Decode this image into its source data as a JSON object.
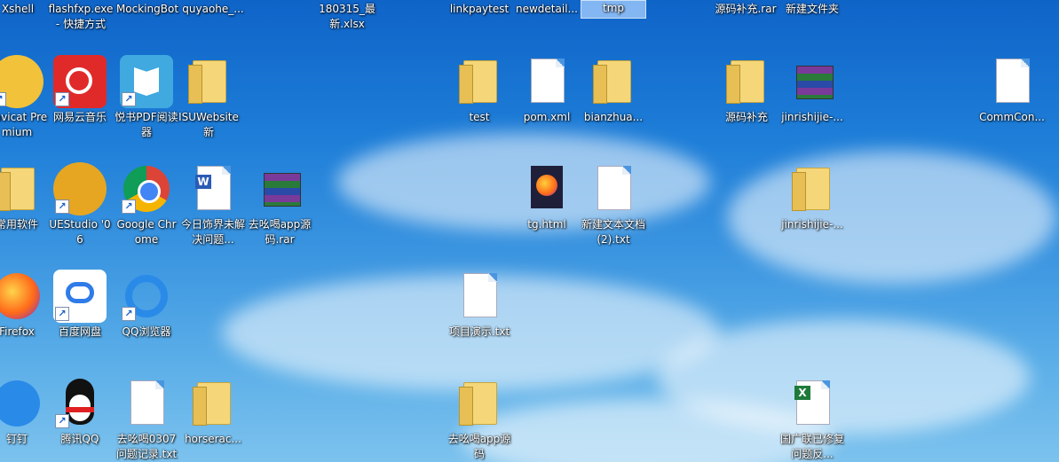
{
  "desktop": {
    "top_row": [
      {
        "label": "Xshell"
      },
      {
        "label": "flashfxp.exe - 快捷方式"
      },
      {
        "label": "MockingBot"
      },
      {
        "label": "quyaohe_..."
      },
      {
        "label": "180315_最新.xlsx"
      },
      {
        "label": "linkpaytest"
      },
      {
        "label": "newdetail..."
      },
      {
        "label": "tmp",
        "selected": true
      },
      {
        "label": "源码补充.rar"
      },
      {
        "label": "新建文件夹"
      }
    ],
    "icons": [
      {
        "label": "Navicat Premium",
        "icon": "navicat-icon",
        "color": "#f2c23a"
      },
      {
        "label": "网易云音乐",
        "icon": "netease-music-icon",
        "color": "#e02a2a"
      },
      {
        "label": "悦书PDF阅读器",
        "icon": "pdf-reader-icon",
        "color": "#3fa9e0"
      },
      {
        "label": "ISUWebsite新",
        "icon": "folder-icon"
      },
      {
        "label": "test",
        "icon": "folder-icon"
      },
      {
        "label": "pom.xml",
        "icon": "file-icon"
      },
      {
        "label": "bianzhua...",
        "icon": "folder-icon"
      },
      {
        "label": "源码补充",
        "icon": "folder-icon"
      },
      {
        "label": "jinrishijie-...",
        "icon": "rar-icon"
      },
      {
        "label": "CommCon...",
        "icon": "file-icon"
      },
      {
        "label": "常用软件",
        "icon": "folder-icon"
      },
      {
        "label": "UEStudio '06",
        "icon": "uestudio-icon",
        "color": "#e6a622"
      },
      {
        "label": "Google Chrome",
        "icon": "chrome-icon"
      },
      {
        "label": "今日饰界未解决问题...",
        "icon": "word-doc-icon"
      },
      {
        "label": "去吆喝app源码.rar",
        "icon": "rar-icon"
      },
      {
        "label": "tg.html",
        "icon": "firefox-file-icon"
      },
      {
        "label": "新建文本文档 (2).txt",
        "icon": "file-icon"
      },
      {
        "label": "jinrishijie-...",
        "icon": "folder-icon"
      },
      {
        "label": "Firefox",
        "icon": "firefox-icon"
      },
      {
        "label": "百度网盘",
        "icon": "baidu-netdisk-icon",
        "color": "#2f7be8"
      },
      {
        "label": "QQ浏览器",
        "icon": "qq-browser-icon",
        "color": "#2a8ae8"
      },
      {
        "label": "项目演示.txt",
        "icon": "file-icon"
      },
      {
        "label": "钉钉",
        "icon": "dingtalk-icon",
        "color": "#2a8ae8"
      },
      {
        "label": "腾讯QQ",
        "icon": "qq-icon"
      },
      {
        "label": "去吆喝0307问题记录.txt",
        "icon": "file-icon"
      },
      {
        "label": "horserac...",
        "icon": "folder-icon"
      },
      {
        "label": "去吆喝app源码",
        "icon": "folder-icon"
      },
      {
        "label": "国广联已修复问题反...",
        "icon": "excel-icon"
      }
    ]
  }
}
